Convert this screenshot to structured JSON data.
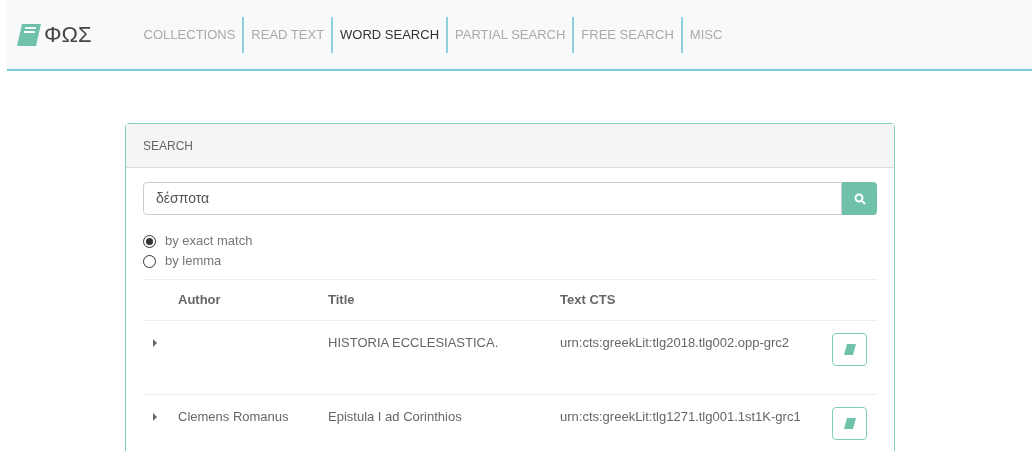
{
  "brand": "ΦΩΣ",
  "nav": [
    {
      "label": "COLLECTIONS",
      "selected": false
    },
    {
      "label": "READ TEXT",
      "selected": false
    },
    {
      "label": "WORD SEARCH",
      "selected": true
    },
    {
      "label": "PARTIAL SEARCH",
      "selected": false
    },
    {
      "label": "FREE SEARCH",
      "selected": false
    },
    {
      "label": "MISC",
      "selected": false
    }
  ],
  "search": {
    "title": "SEARCH",
    "value": "δέσποτα",
    "options": [
      {
        "label": "by exact match",
        "selected": true
      },
      {
        "label": "by lemma",
        "selected": false
      }
    ]
  },
  "table": {
    "columns": [
      "Author",
      "Title",
      "Text CTS"
    ],
    "rows": [
      {
        "author": "",
        "title": "HISTORIA ECCLESIASTICA.",
        "cts": "urn:cts:greekLit:tlg2018.tlg002.opp-grc2"
      },
      {
        "author": "Clemens Romanus",
        "title": "Epistula I ad Corinthios",
        "cts": "urn:cts:greekLit:tlg1271.tlg001.1st1K-grc1"
      }
    ]
  }
}
